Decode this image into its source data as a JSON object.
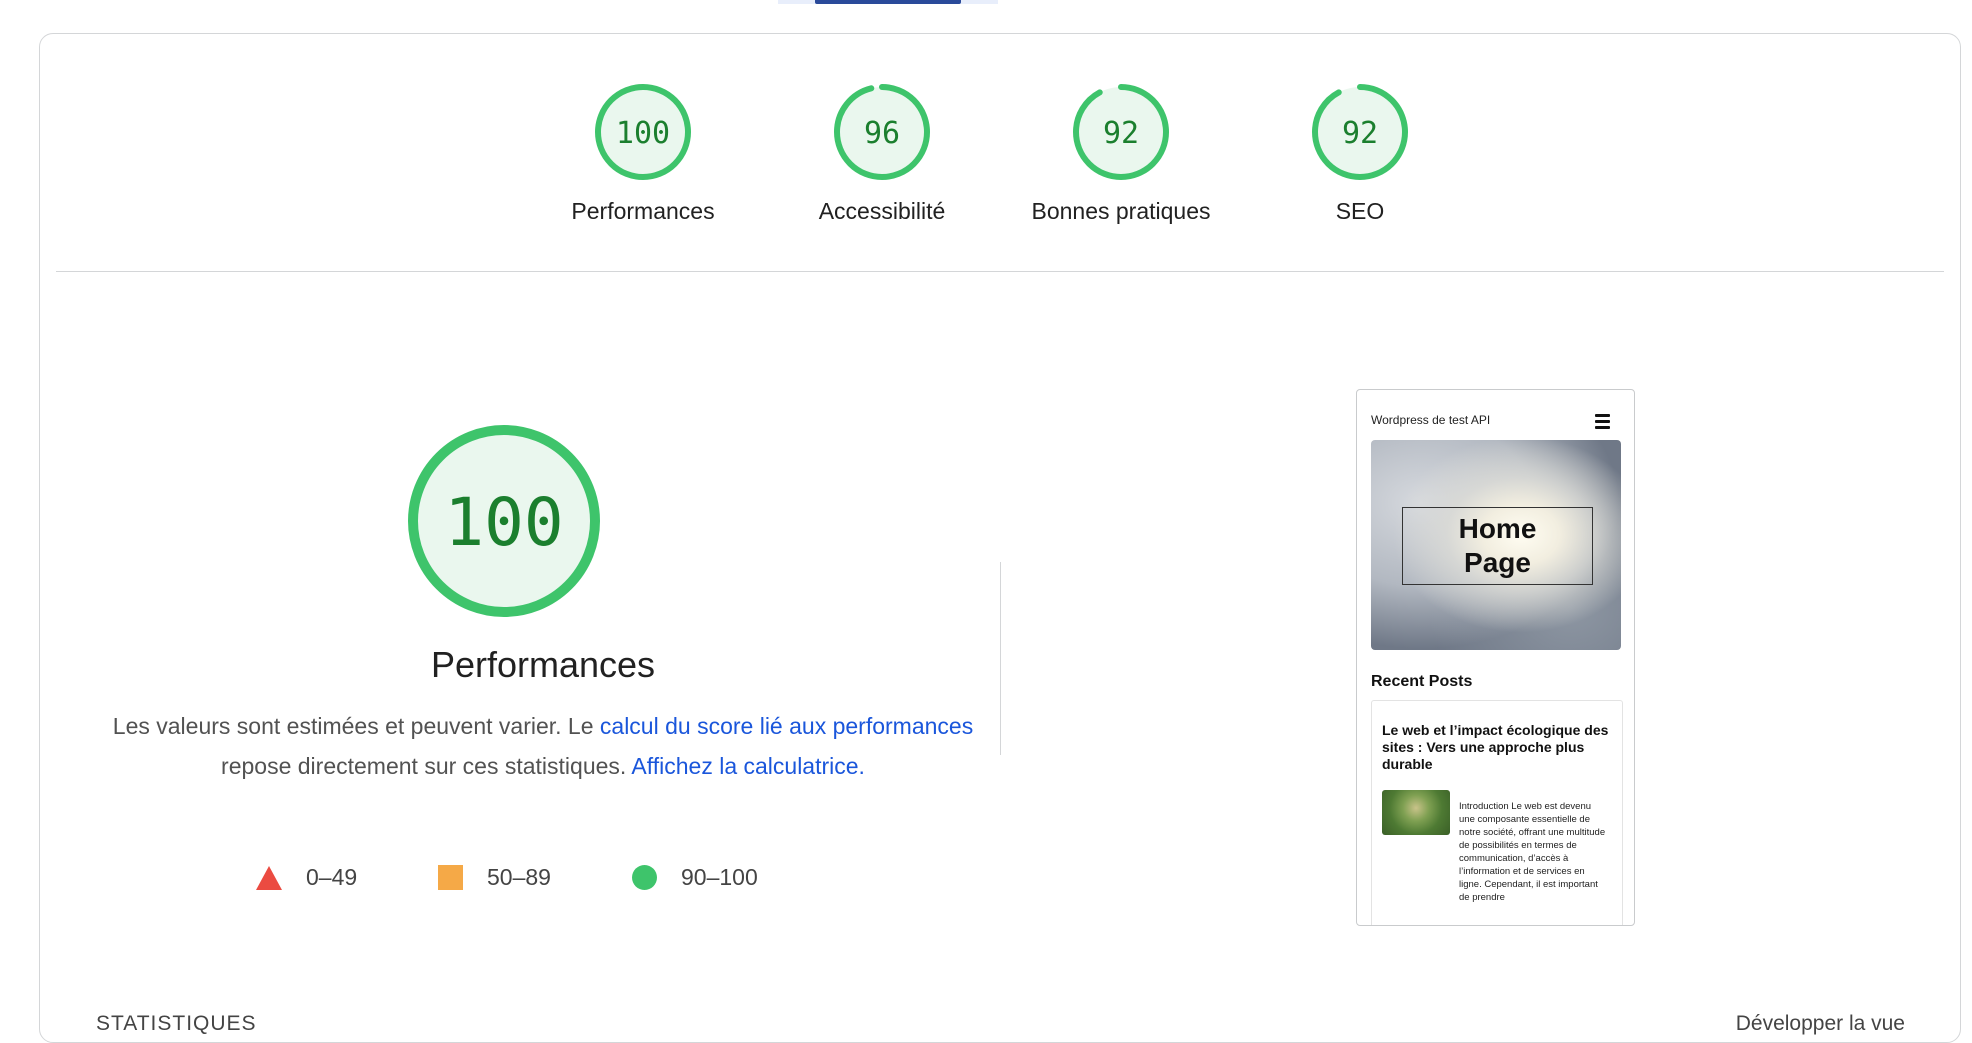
{
  "gauges": [
    {
      "label": "Performances",
      "score": "100",
      "value": 100
    },
    {
      "label": "Accessibilité",
      "score": "96",
      "value": 96
    },
    {
      "label": "Bonnes pratiques",
      "score": "92",
      "value": 92
    },
    {
      "label": "SEO",
      "score": "92",
      "value": 92
    }
  ],
  "performance": {
    "score": "100",
    "value": 100,
    "title": "Performances",
    "desc_part1": "Les valeurs sont estimées et peuvent varier. Le ",
    "desc_link1": "calcul du score lié aux performances",
    "desc_part2": " repose directement sur ces statistiques. ",
    "desc_link2": "Affichez la calculatrice."
  },
  "legend": [
    {
      "range": "0–49",
      "shape": "triangle",
      "color": "#eb4b41"
    },
    {
      "range": "50–89",
      "shape": "square",
      "color": "#f5a947"
    },
    {
      "range": "90–100",
      "shape": "circle",
      "color": "#3ec46b"
    }
  ],
  "screenshot": {
    "site_title": "Wordpress de test API",
    "hero_line1": "Home",
    "hero_line2": "Page",
    "section_title": "Recent Posts",
    "post_title": "Le web et l’impact écologique des sites : Vers une approche plus durable",
    "post_excerpt": "Introduction Le web est devenu une composante essentielle de notre société, offrant une multitude de possibilités en termes de communication, d’accès à l’information et de services en ligne. Cependant, il est important de prendre"
  },
  "footer": {
    "stats_label": "STATISTIQUES",
    "expand_label": "Développer la vue"
  },
  "colors": {
    "pass": "#3ec46b",
    "pass_text": "#1b7f2e",
    "pass_bg": "#eaf7ee",
    "link": "#1a56db"
  }
}
